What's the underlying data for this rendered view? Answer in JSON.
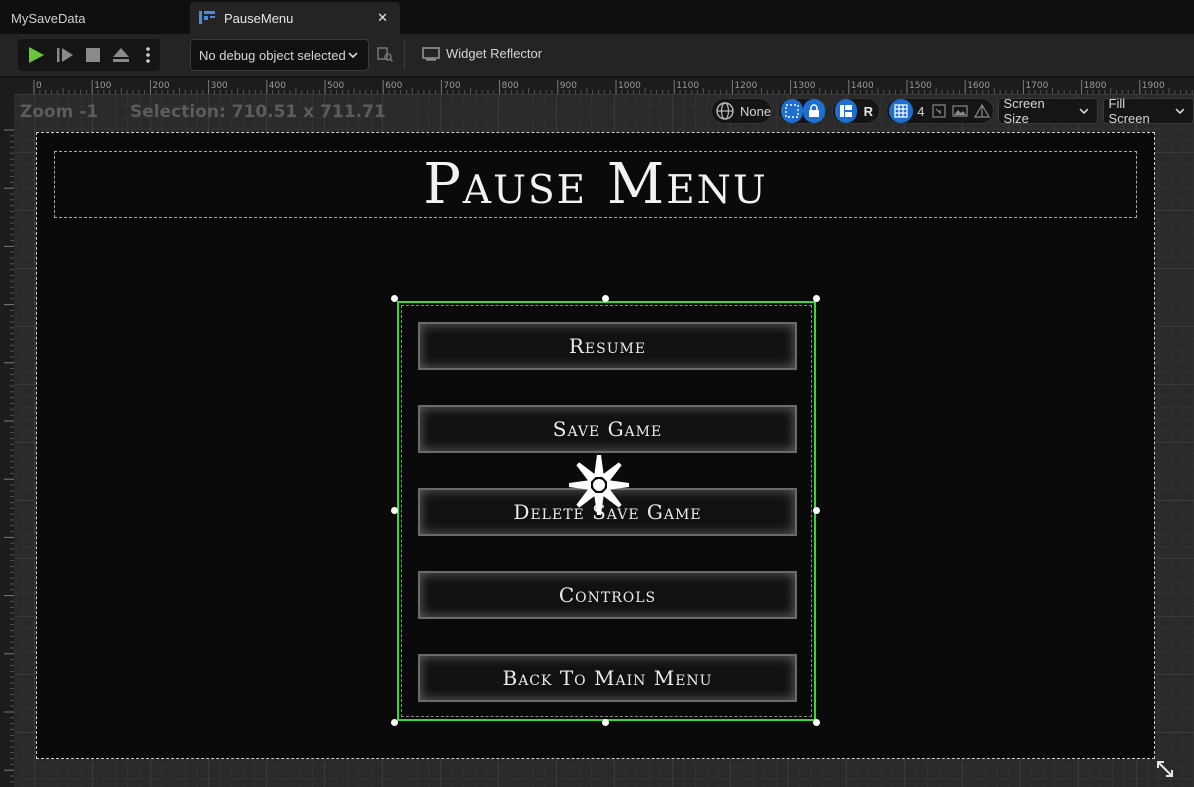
{
  "tabs": [
    {
      "label": "MySaveData",
      "active": false
    },
    {
      "label": "PauseMenu",
      "active": true
    }
  ],
  "toolbar": {
    "debug_select": "No debug object selected",
    "widget_reflector": "Widget Reflector"
  },
  "ruler": {
    "ticks": [
      "0",
      "100",
      "200",
      "300",
      "400",
      "500",
      "600",
      "700",
      "800",
      "900",
      "1000",
      "1100",
      "1200",
      "1300",
      "1400",
      "1500",
      "1600",
      "1700",
      "1800",
      "1900"
    ]
  },
  "canvas": {
    "zoom": "Zoom -1",
    "selection": "Selection: 710.51 x 711.71",
    "locale": "None",
    "respect_locks": "R",
    "grid_snap": "4",
    "screen_size": "Screen Size",
    "fill_mode": "Fill Screen"
  },
  "menu": {
    "title": "Pause Menu",
    "buttons": [
      "Resume",
      "Save Game",
      "Delete Save Game",
      "Controls",
      "Back To Main Menu"
    ]
  },
  "colors": {
    "selection_outline": "#3ad63a",
    "accent_blue": "#1e6fd0",
    "play_green": "#6bc63a"
  }
}
